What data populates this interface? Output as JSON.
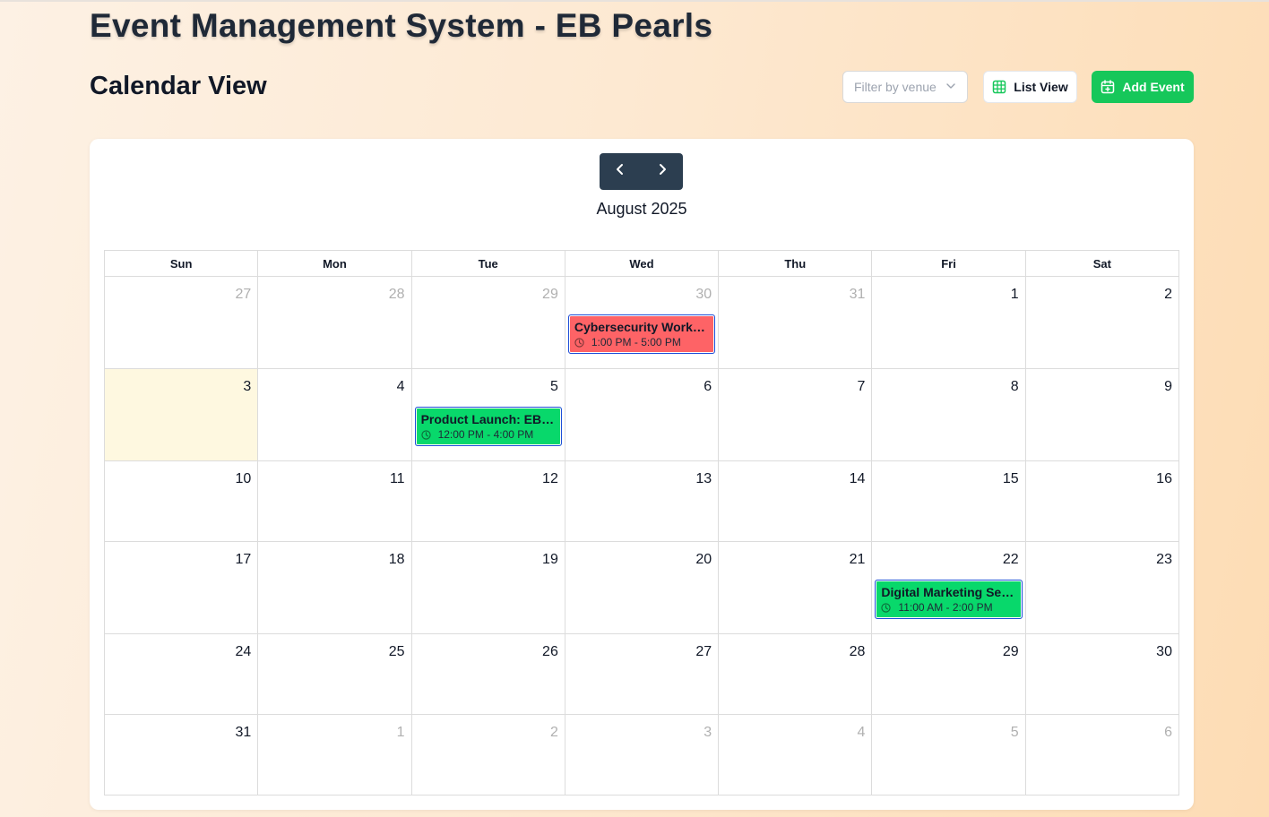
{
  "app_title": "Event Management System - EB Pearls",
  "page_title": "Calendar View",
  "toolbar": {
    "venue_filter_placeholder": "Filter by venue",
    "list_view_label": "List View",
    "add_event_label": "Add Event"
  },
  "colors": {
    "accent_green": "#16c75a",
    "event_green": "#08d86b",
    "event_red": "#fe6366",
    "nav_dark": "#2c3e50",
    "today_highlight": "#fef8e0"
  },
  "calendar": {
    "month_label": "August 2025",
    "weekdays": [
      "Sun",
      "Mon",
      "Tue",
      "Wed",
      "Thu",
      "Fri",
      "Sat"
    ],
    "today": "3",
    "weeks": [
      [
        {
          "day": "27",
          "other": true
        },
        {
          "day": "28",
          "other": true
        },
        {
          "day": "29",
          "other": true
        },
        {
          "day": "30",
          "other": true,
          "event": {
            "title": "Cybersecurity Worksh...",
            "time": "1:00 PM - 5:00 PM",
            "color": "#fe6366"
          }
        },
        {
          "day": "31",
          "other": true
        },
        {
          "day": "1",
          "other": false
        },
        {
          "day": "2",
          "other": false
        }
      ],
      [
        {
          "day": "3",
          "other": false,
          "today": true
        },
        {
          "day": "4",
          "other": false
        },
        {
          "day": "5",
          "other": false,
          "event": {
            "title": "Product Launch: EB Pe...",
            "time": "12:00 PM - 4:00 PM",
            "color": "#08d86b"
          }
        },
        {
          "day": "6",
          "other": false
        },
        {
          "day": "7",
          "other": false
        },
        {
          "day": "8",
          "other": false
        },
        {
          "day": "9",
          "other": false
        }
      ],
      [
        {
          "day": "10",
          "other": false
        },
        {
          "day": "11",
          "other": false
        },
        {
          "day": "12",
          "other": false
        },
        {
          "day": "13",
          "other": false
        },
        {
          "day": "14",
          "other": false
        },
        {
          "day": "15",
          "other": false
        },
        {
          "day": "16",
          "other": false
        }
      ],
      [
        {
          "day": "17",
          "other": false
        },
        {
          "day": "18",
          "other": false
        },
        {
          "day": "19",
          "other": false
        },
        {
          "day": "20",
          "other": false
        },
        {
          "day": "21",
          "other": false
        },
        {
          "day": "22",
          "other": false,
          "event": {
            "title": "Digital Marketing Sem...",
            "time": "11:00 AM - 2:00 PM",
            "color": "#08d86b"
          }
        },
        {
          "day": "23",
          "other": false
        }
      ],
      [
        {
          "day": "24",
          "other": false
        },
        {
          "day": "25",
          "other": false
        },
        {
          "day": "26",
          "other": false
        },
        {
          "day": "27",
          "other": false
        },
        {
          "day": "28",
          "other": false
        },
        {
          "day": "29",
          "other": false
        },
        {
          "day": "30",
          "other": false
        }
      ],
      [
        {
          "day": "31",
          "other": false
        },
        {
          "day": "1",
          "other": true
        },
        {
          "day": "2",
          "other": true
        },
        {
          "day": "3",
          "other": true
        },
        {
          "day": "4",
          "other": true
        },
        {
          "day": "5",
          "other": true
        },
        {
          "day": "6",
          "other": true
        }
      ]
    ]
  }
}
